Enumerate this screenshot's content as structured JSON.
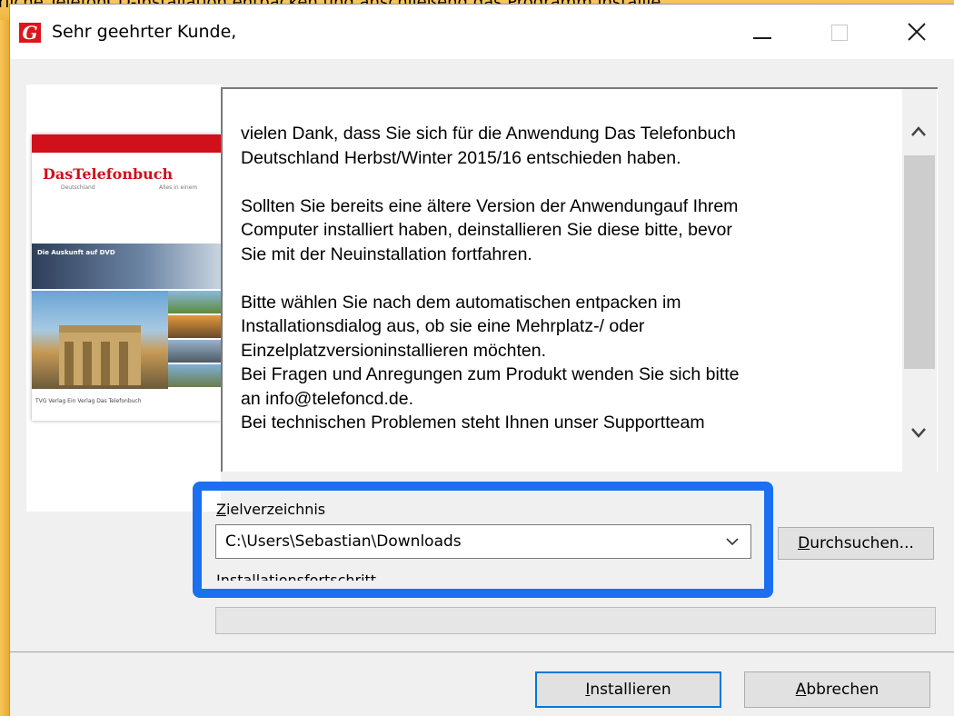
{
  "background_caption": "rliche TelefonCD-Installation entpacken und anschließend das Programm installie",
  "window": {
    "title": "Sehr geehrter Kunde,",
    "minimize": "—",
    "maximize": "□",
    "close": "✕"
  },
  "product_image": {
    "logo_text": "DasTelefonbuch",
    "sub_left": "Deutschland",
    "sub_right": "Alles in einem",
    "dvd_text": "Die Auskunft auf DVD",
    "footer": "TVG Verlag   Ein Verlag Das Telefonbuch"
  },
  "message": {
    "paragraphs": [
      [
        "vielen Dank, dass Sie sich für die Anwendung Das Telefonbuch",
        "Deutschland Herbst/Winter 2015/16 entschieden haben."
      ],
      [
        "Sollten Sie bereits eine ältere Version der Anwendungauf Ihrem",
        "Computer installiert haben, deinstallieren Sie diese bitte, bevor",
        "Sie mit der Neuinstallation fortfahren."
      ],
      [
        "Bitte wählen Sie nach dem automatischen entpacken im",
        "Installationsdialog aus, ob sie eine Mehrplatz-/ oder",
        "Einzelplatzversioninstallieren möchten.",
        "Bei Fragen und Anregungen zum Produkt wenden Sie sich bitte",
        "an info@telefoncd.de.",
        "Bei technischen Problemen steht Ihnen unser Supportteam"
      ]
    ]
  },
  "target": {
    "label_first": "Z",
    "label_rest": "ielverzeichnis",
    "path": "C:\\Users\\Sebastian\\Downloads",
    "browse_first": "D",
    "browse_rest": "urchsuchen..."
  },
  "progress": {
    "label": "Installationsfortschritt",
    "value": 0
  },
  "buttons": {
    "install_first": "I",
    "install_rest": "nstallieren",
    "cancel_first": "A",
    "cancel_rest": "bbrechen"
  },
  "colors": {
    "highlight": "#1a70f0",
    "default_button_border": "#0078d7",
    "brand_red": "#d0101a"
  }
}
